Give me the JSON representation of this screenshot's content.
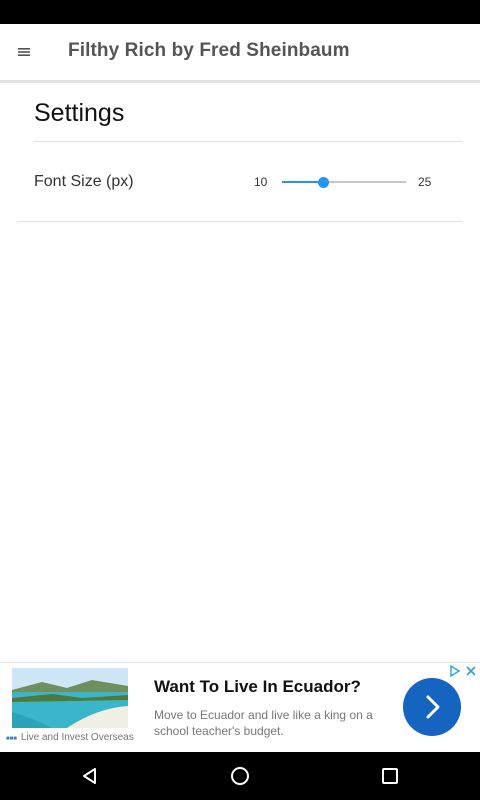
{
  "app_bar": {
    "title": "Filthy Rich by Fred Sheinbaum",
    "menu_icon": "hamburger-menu-icon"
  },
  "settings": {
    "title": "Settings",
    "font_size": {
      "label": "Font Size (px)",
      "min": "10",
      "max": "25",
      "value": 15
    }
  },
  "ad": {
    "headline": "Want To Live In Ecuador?",
    "description": "Move to Ecuador and live like a king on a school teacher's budget.",
    "source": "Live and Invest Overseas",
    "go_icon": "chevron-right-icon",
    "choices_icon": "ad-choices-icon",
    "close_icon": "close-icon"
  },
  "colors": {
    "accent": "#2196f3",
    "ad_button": "#1565c0",
    "title_text": "#555555"
  },
  "nav": {
    "back_icon": "back-icon",
    "home_icon": "home-icon",
    "recents_icon": "recents-icon"
  }
}
